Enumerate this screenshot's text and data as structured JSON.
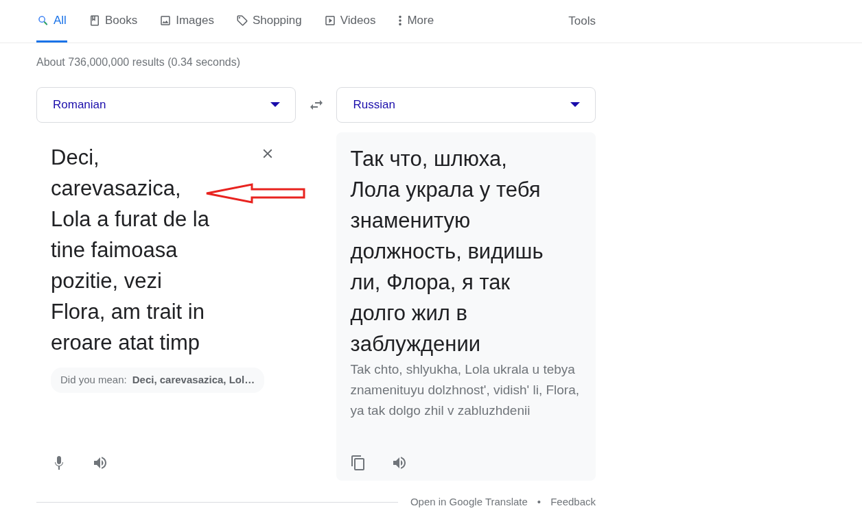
{
  "tabs": [
    {
      "label": "All",
      "selected": true
    },
    {
      "label": "Books",
      "selected": false
    },
    {
      "label": "Images",
      "selected": false
    },
    {
      "label": "Shopping",
      "selected": false
    },
    {
      "label": "Videos",
      "selected": false
    },
    {
      "label": "More",
      "selected": false
    }
  ],
  "tools": "Tools",
  "result_stats": "About 736,000,000 results (0.34 seconds)",
  "translator": {
    "source_language": "Romanian",
    "target_language": "Russian",
    "source_text": "Deci, carevasazica, Lola a furat de la tine faimoasa pozitie, vezi Flora, am trait in eroare atat timp",
    "did_you_mean": {
      "label": "Did you mean:",
      "suggestion": "Deci, carevasazica, Lol…"
    },
    "translation": "Так что, шлюха, Лола украла у тебя знаменитую должность, видишь ли, Флора, я так долго жил в заблуждении",
    "transliteration": "Tak chto, shlyukha, Lola ukrala u tebya znamenituyu dolzhnost', vidish' li, Flora, ya tak dolgo zhil v zabluzhdenii",
    "footer_links": [
      "Open in Google Translate",
      "Feedback"
    ],
    "footer_separator": "•"
  }
}
